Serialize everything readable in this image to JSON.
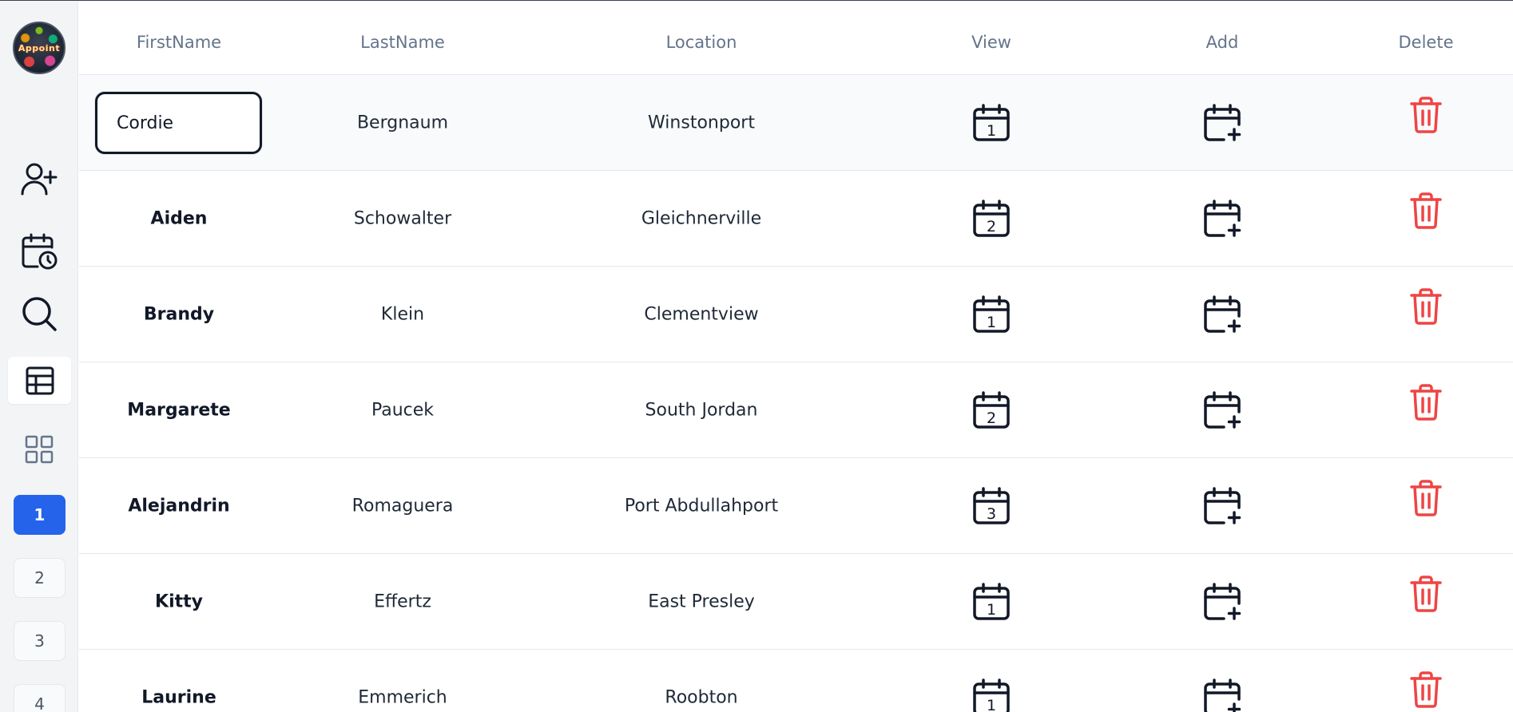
{
  "app": {
    "logo_text": "Appoint"
  },
  "sidebar": {
    "icons": [
      "add-user-icon",
      "calendar-clock-icon",
      "search-icon",
      "table-icon",
      "grid-icon"
    ],
    "pages": [
      "1",
      "2",
      "3",
      "4"
    ],
    "active_page": "1"
  },
  "table": {
    "headers": {
      "first_name": "FirstName",
      "last_name": "LastName",
      "location": "Location",
      "view": "View",
      "add": "Add",
      "delete": "Delete"
    },
    "rows": [
      {
        "first": "Cordie",
        "last": "Bergnaum",
        "location": "Winstonport",
        "count": "1"
      },
      {
        "first": "Aiden",
        "last": "Schowalter",
        "location": "Gleichnerville",
        "count": "2"
      },
      {
        "first": "Brandy",
        "last": "Klein",
        "location": "Clementview",
        "count": "1"
      },
      {
        "first": "Margarete",
        "last": "Paucek",
        "location": "South Jordan",
        "count": "2"
      },
      {
        "first": "Alejandrin",
        "last": "Romaguera",
        "location": "Port Abdullahport",
        "count": "3"
      },
      {
        "first": "Kitty",
        "last": "Effertz",
        "location": "East Presley",
        "count": "1"
      },
      {
        "first": "Laurine",
        "last": "Emmerich",
        "location": "Roobton",
        "count": "1"
      }
    ]
  },
  "colors": {
    "accent": "#2563eb",
    "delete": "#ef4444",
    "header_text": "#64748b"
  }
}
